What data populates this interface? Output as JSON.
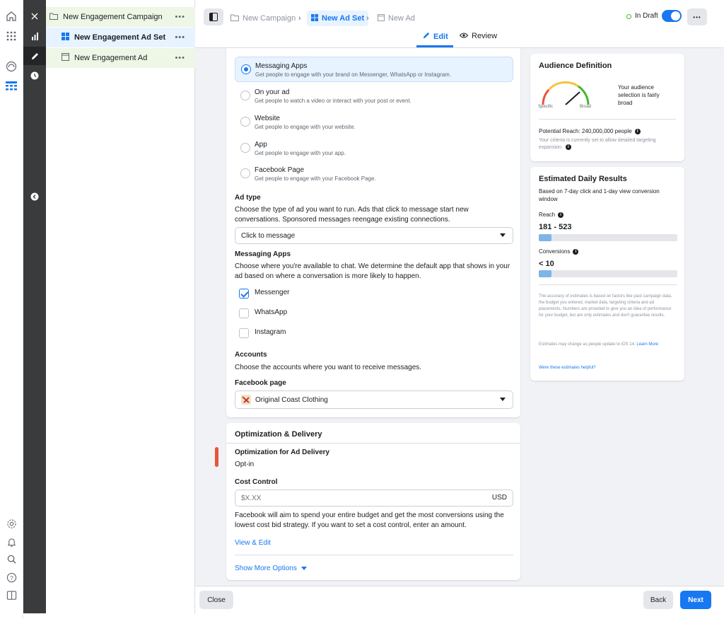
{
  "tree": {
    "items": [
      {
        "label": "New Engagement Campaign"
      },
      {
        "label": "New Engagement Ad Set"
      },
      {
        "label": "New Engagement Ad"
      }
    ],
    "more": "•••"
  },
  "breadcrumb": {
    "campaign": "New Campaign",
    "adset": "New Ad Set",
    "ad": "New Ad"
  },
  "status": {
    "label": "In Draft",
    "more": "•••"
  },
  "tabs": {
    "edit": "Edit",
    "review": "Review"
  },
  "destination": {
    "options": [
      {
        "title": "Messaging Apps",
        "desc": "Get people to engage with your brand on Messenger, WhatsApp or Instagram.",
        "selected": true
      },
      {
        "title": "On your ad",
        "desc": "Get people to watch a video or interact with your post or event.",
        "selected": false
      },
      {
        "title": "Website",
        "desc": "Get people to engage with your website.",
        "selected": false
      },
      {
        "title": "App",
        "desc": "Get people to engage with your app.",
        "selected": false
      },
      {
        "title": "Facebook Page",
        "desc": "Get people to engage with your Facebook Page.",
        "selected": false
      }
    ]
  },
  "ad_type": {
    "label": "Ad type",
    "desc": "Choose the type of ad you want to run. Ads that click to message start new conversations. Sponsored messages reengage existing connections.",
    "value": "Click to message"
  },
  "messaging_apps": {
    "label": "Messaging Apps",
    "desc": "Choose where you're available to chat. We determine the default app that shows in your ad based on where a conversation is more likely to happen.",
    "apps": [
      {
        "label": "Messenger",
        "checked": true
      },
      {
        "label": "WhatsApp",
        "checked": false
      },
      {
        "label": "Instagram",
        "checked": false
      }
    ]
  },
  "accounts": {
    "label": "Accounts",
    "desc": "Choose the accounts where you want to receive messages.",
    "page_label": "Facebook page",
    "page_value": "Original Coast Clothing"
  },
  "optimization": {
    "title": "Optimization & Delivery",
    "ad_delivery_label": "Optimization for Ad Delivery",
    "ad_delivery_value": "Opt-in",
    "cost_label": "Cost Control",
    "cost_placeholder": "$X.XX",
    "currency": "USD",
    "desc": "Facebook will aim to spend your entire budget and get the most conversions using the lowest cost bid strategy. If you want to set a cost control, enter an amount.",
    "view_edit": "View & Edit",
    "show_more": "Show More Options"
  },
  "audience": {
    "title": "Audience Definition",
    "specific": "Specific",
    "broad": "Broad",
    "summary": "Your audience selection is fairly broad",
    "potential_reach": "Potential Reach: 240,000,000 people",
    "note": "Your criteria is currently set to allow detailed targeting expansion."
  },
  "estimates": {
    "title": "Estimated Daily Results",
    "subtitle": "Based on 7-day click and 1-day view conversion window",
    "reach_label": "Reach",
    "reach_value": "181 - 523",
    "reach_fraction": 0.09,
    "conversions_label": "Conversions",
    "conversions_value": "< 10",
    "conversions_fraction": 0.09,
    "disclaimer": "The accuracy of estimates is based on factors like past campaign data, the budget you entered, market data, targeting criteria and ad placements. Numbers are provided to give you an idea of performance for your budget, but are only estimates and don't guarantee results.",
    "ios_note": "Estimates may change as people update to iOS 14.",
    "learn_more": "Learn More",
    "helpful": "Were these estimates helpful?"
  },
  "footer": {
    "close": "Close",
    "back": "Back",
    "next": "Next"
  },
  "colors": {
    "accent": "#1877f2",
    "tree_highlight": "#e7f3ff",
    "tree_green": "#eef6e6",
    "marker": "#e8543b"
  }
}
